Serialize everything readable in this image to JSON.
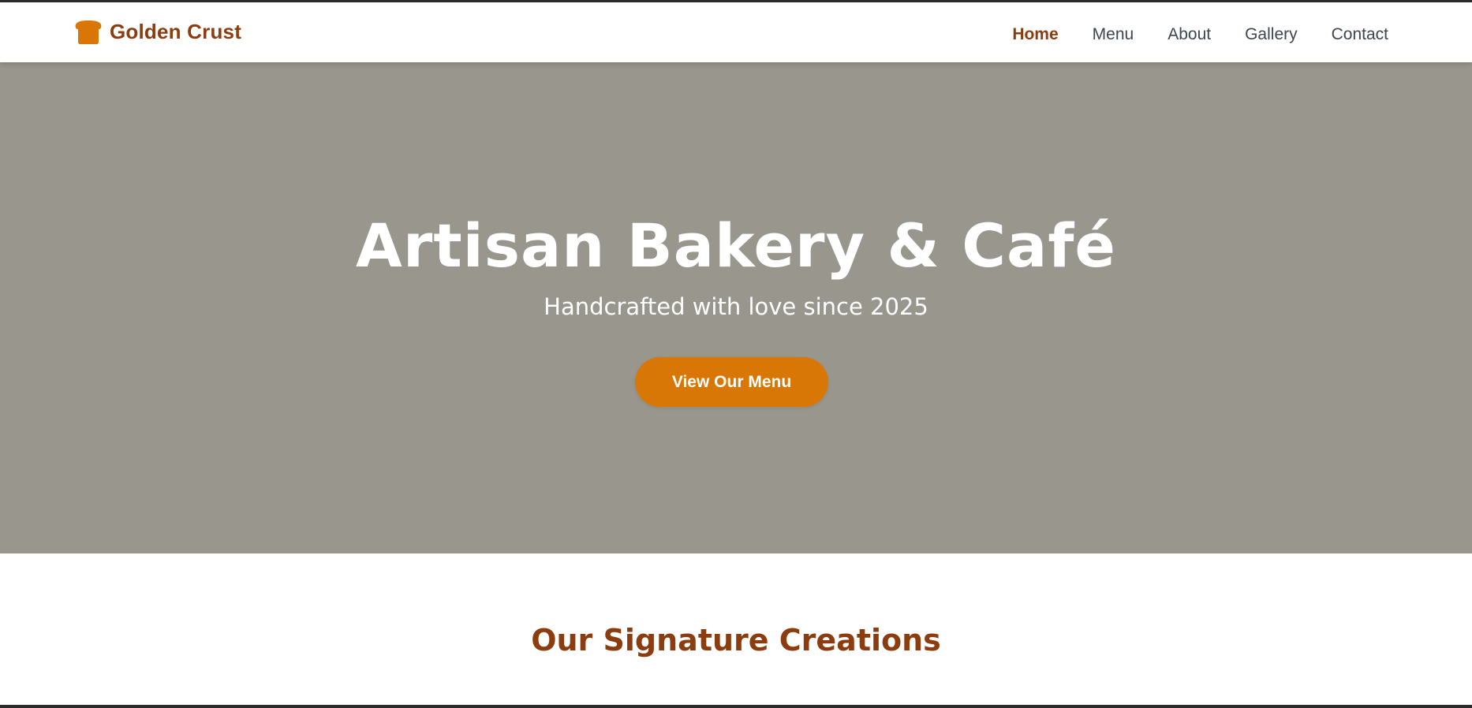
{
  "colors": {
    "brand": "#8b3d0f",
    "accent": "#d97706",
    "hero_bg": "#98968d",
    "nav_text": "#3d4552"
  },
  "header": {
    "brand_icon": "bread-icon",
    "brand_name": "Golden Crust",
    "nav": [
      {
        "label": "Home",
        "active": true
      },
      {
        "label": "Menu",
        "active": false
      },
      {
        "label": "About",
        "active": false
      },
      {
        "label": "Gallery",
        "active": false
      },
      {
        "label": "Contact",
        "active": false
      }
    ]
  },
  "hero": {
    "title": "Artisan Bakery & Café",
    "subtitle": "Handcrafted with love since 2025",
    "cta_label": "View Our Menu"
  },
  "signature": {
    "title": "Our Signature Creations"
  }
}
